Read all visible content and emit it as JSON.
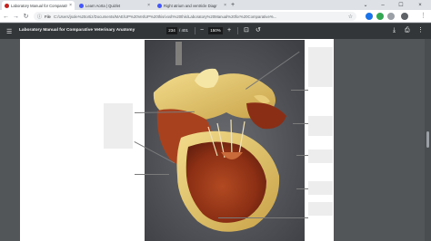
{
  "tabs": [
    {
      "label": "Laboratory Manual for Comparative",
      "active": true,
      "favicon_color": "#c5221f"
    },
    {
      "label": "Learn Aorta | Quizlet",
      "active": false,
      "favicon_color": "#4255ff"
    },
    {
      "label": "Right atrium and ventricle Diagr",
      "active": false,
      "favicon_color": "#4255ff"
    }
  ],
  "address_bar": {
    "scheme": "File",
    "url": "C:/Users/jsole%20ortiz/Documents/MAE/UP%20Vet/UP%20this/vosh%20this/Laboratory%20Manual%20for%20Comparative%..."
  },
  "pdf_viewer": {
    "title": "Laboratory Manual for Comparative Veterinary Anatomy",
    "page_current": "234",
    "page_total": "/ 401",
    "zoom_minus": "−",
    "zoom": "150%",
    "zoom_plus": "+"
  },
  "icons": {
    "menu": "hamburger-icon",
    "download": "download-icon",
    "print": "print-icon",
    "more": "more-vert-icon",
    "fit": "fit-page-icon",
    "rotate": "rotate-icon"
  }
}
